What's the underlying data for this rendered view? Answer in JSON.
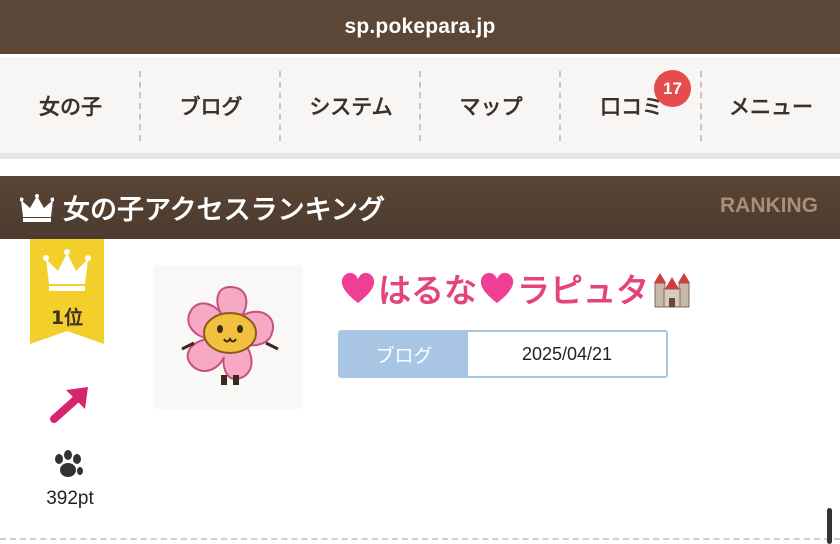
{
  "browser": {
    "url": "sp.pokepara.jp"
  },
  "nav": {
    "items": [
      {
        "label": "女の子"
      },
      {
        "label": "ブログ"
      },
      {
        "label": "システム"
      },
      {
        "label": "マップ"
      },
      {
        "label": "口コミ",
        "badge": "17"
      },
      {
        "label": "メニュー"
      }
    ]
  },
  "section": {
    "title": "女の子アクセスランキング",
    "subtitle": "RANKING"
  },
  "ranking": {
    "rank": "1位",
    "trend": "up",
    "points": "392pt",
    "name_prefix_emoji": "pink-heart",
    "name_part1": "はるな",
    "name_mid_emoji": "pink-heart",
    "name_part2": "ラピュタ",
    "name_suffix_emoji": "castle",
    "tag_label": "ブログ",
    "date": "2025/04/21"
  },
  "colors": {
    "header_bg": "#5b4738",
    "accent_pink": "#e3447b",
    "ribbon_gold": "#f2cf2a",
    "badge_red": "#e64c4c",
    "tag_blue": "#a9c5e4"
  }
}
